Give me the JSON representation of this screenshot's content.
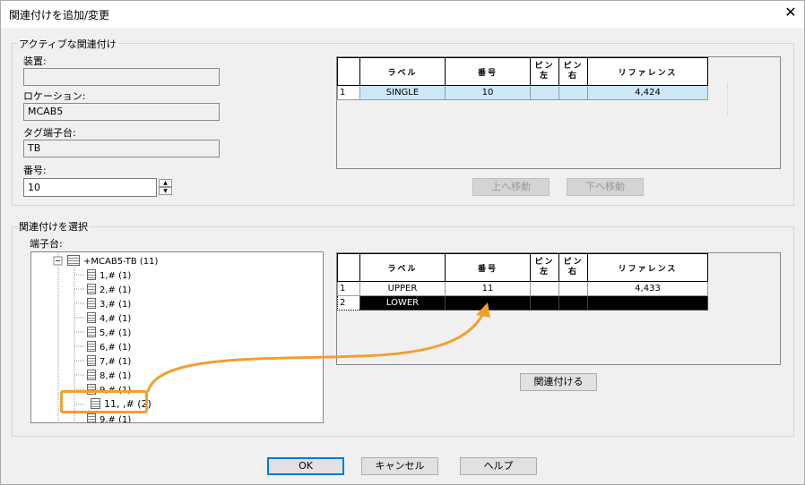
{
  "window": {
    "title": "関連付けを追加/変更",
    "close_glyph": "✕"
  },
  "active": {
    "group_label": "アクティブな関連付け",
    "device_label": "装置:",
    "device_value": "",
    "location_label": "ロケーション:",
    "location_value": "MCAB5",
    "tag_label": "タグ端子台:",
    "tag_value": "TB",
    "number_label": "番号:",
    "number_value": "10",
    "table": {
      "headers": {
        "label": "ラベル",
        "number": "番号",
        "pin_left": "ピン左",
        "pin_right": "ピン右",
        "reference": "リファレンス"
      },
      "rows": [
        {
          "index": "1",
          "label": "SINGLE",
          "number": "10",
          "pin_left": "",
          "pin_right": "",
          "reference": "4,424"
        }
      ]
    },
    "move_up": "上へ移動",
    "move_down": "下へ移動"
  },
  "select": {
    "group_label": "関連付けを選択",
    "terminal_label": "端子台:",
    "tree": {
      "root": "+MCAB5-TB (11)",
      "items": [
        "1,# (1)",
        "2,# (1)",
        "3,# (1)",
        "4,# (1)",
        "5,# (1)",
        "6,# (1)",
        "7,# (1)",
        "8,# (1)",
        "9,# (1)",
        "11, ,# (2)",
        "9,# (1)"
      ]
    },
    "table": {
      "headers": {
        "label": "ラベル",
        "number": "番号",
        "pin_left": "ピン左",
        "pin_right": "ピン右",
        "reference": "リファレンス"
      },
      "rows": [
        {
          "index": "1",
          "label": "UPPER",
          "number": "11",
          "pin_left": "",
          "pin_right": "",
          "reference": "4,433"
        },
        {
          "index": "2",
          "label": "LOWER",
          "number": "",
          "pin_left": "",
          "pin_right": "",
          "reference": ""
        }
      ]
    },
    "associate": "関連付ける"
  },
  "footer": {
    "ok": "OK",
    "cancel": "キャンセル",
    "help": "ヘルプ"
  },
  "colors": {
    "highlight_orange": "#f0a030",
    "selected_row": "#cce8f8",
    "black_row": "#000000"
  }
}
